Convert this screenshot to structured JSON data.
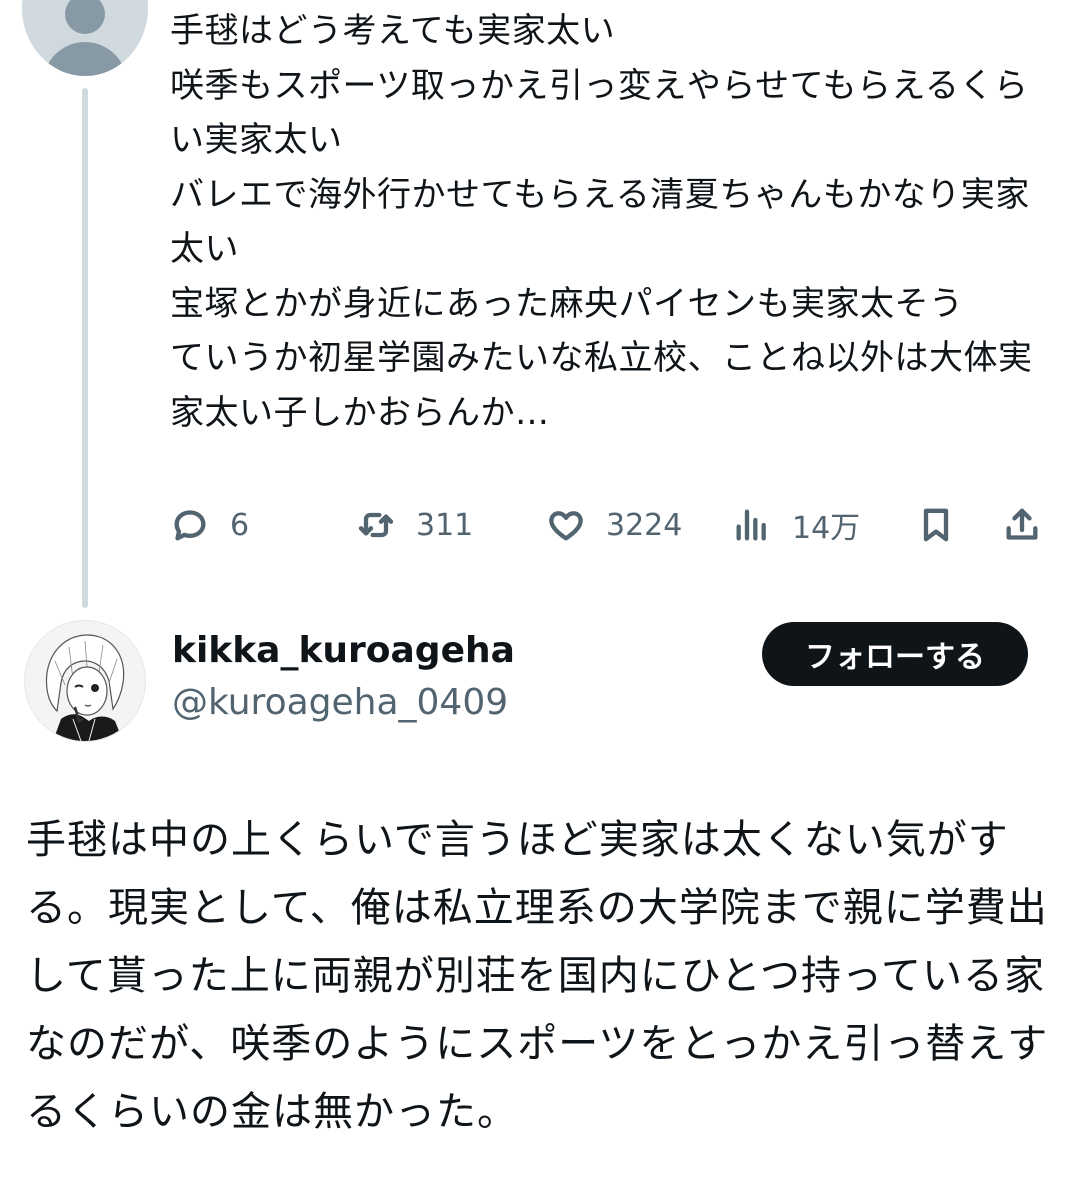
{
  "parent_post": {
    "text": "手毬はどう考えても実家太い\n咲季もスポーツ取っかえ引っ変えやらせてもらえるくらい実家太い\nバレエで海外行かせてもらえる清夏ちゃんもかなり実家太い\n宝塚とかが身近にあった麻央パイセンも実家太そう\nていうか初星学園みたいな私立校、ことね以外は大体実家太い子しかおらんか…",
    "actions": {
      "reply_count": "6",
      "retweet_count": "311",
      "like_count": "3224",
      "views_count": "14万"
    },
    "icons": [
      "reply-icon",
      "retweet-icon",
      "like-icon",
      "views-icon",
      "bookmark-icon",
      "share-icon"
    ]
  },
  "reply_post": {
    "display_name": "kikka_kuroageha",
    "handle": "@kuroageha_0409",
    "follow_label": "フォローする",
    "text": "手毬は中の上くらいで言うほど実家は太くない気がする。現実として、俺は私立理系の大学院まで親に学費出して貰った上に両親が別荘を国内にひとつ持っている家なのだが、咲季のようにスポーツをとっかえ引っ替えするくらいの金は無かった。"
  },
  "colors": {
    "text": "#0f1419",
    "secondary": "#536471",
    "thread_line": "#cfd9de",
    "button_bg": "#0f1419",
    "button_text": "#ffffff"
  }
}
